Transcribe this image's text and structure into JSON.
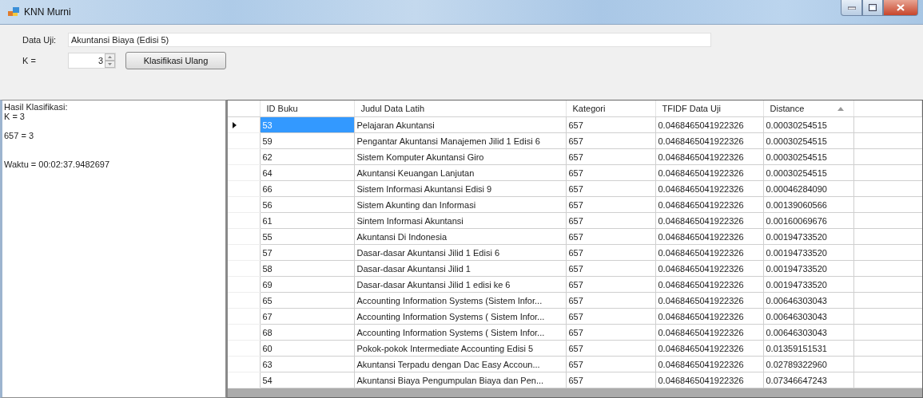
{
  "window": {
    "title": "KNN Murni"
  },
  "form": {
    "data_uji": {
      "label": "Data Uji:",
      "value": "Akuntansi Biaya (Edisi 5)"
    },
    "k": {
      "label": "K =",
      "value": "3"
    },
    "button": "Klasifikasi Ulang"
  },
  "result_text": "Hasil Klasifikasi:\nK = 3\n\n657 = 3\n\n\nWaktu = 00:02:37.9482697",
  "table": {
    "columns": [
      {
        "label": "ID Buku",
        "sorted": false
      },
      {
        "label": "Judul Data Latih",
        "sorted": false
      },
      {
        "label": "Kategori",
        "sorted": false
      },
      {
        "label": "TFIDF Data Uji",
        "sorted": false
      },
      {
        "label": "Distance",
        "sorted": true
      }
    ],
    "rows": [
      {
        "selected": true,
        "cells": [
          "53",
          "Pelajaran Akuntansi",
          "657",
          "0.0468465041922326",
          "0.00030254515"
        ]
      },
      {
        "selected": false,
        "cells": [
          "59",
          "Pengantar Akuntansi Manajemen Jilid 1 Edisi 6",
          "657",
          "0.0468465041922326",
          "0.00030254515"
        ]
      },
      {
        "selected": false,
        "cells": [
          "62",
          "Sistem Komputer Akuntansi Giro",
          "657",
          "0.0468465041922326",
          "0.00030254515"
        ]
      },
      {
        "selected": false,
        "cells": [
          "64",
          "Akuntansi Keuangan Lanjutan",
          "657",
          "0.0468465041922326",
          "0.00030254515"
        ]
      },
      {
        "selected": false,
        "cells": [
          "66",
          "Sistem Informasi Akuntansi Edisi 9",
          "657",
          "0.0468465041922326",
          "0.00046284090"
        ]
      },
      {
        "selected": false,
        "cells": [
          "56",
          "Sistem Akunting dan Informasi",
          "657",
          "0.0468465041922326",
          "0.00139060566"
        ]
      },
      {
        "selected": false,
        "cells": [
          "61",
          "Sintem Informasi Akuntansi",
          "657",
          "0.0468465041922326",
          "0.00160069676"
        ]
      },
      {
        "selected": false,
        "cells": [
          "55",
          "Akuntansi Di Indonesia",
          "657",
          "0.0468465041922326",
          "0.00194733520"
        ]
      },
      {
        "selected": false,
        "cells": [
          "57",
          "Dasar-dasar Akuntansi  Jilid 1 Edisi 6",
          "657",
          "0.0468465041922326",
          "0.00194733520"
        ]
      },
      {
        "selected": false,
        "cells": [
          "58",
          "Dasar-dasar Akuntansi Jilid 1",
          "657",
          "0.0468465041922326",
          "0.00194733520"
        ]
      },
      {
        "selected": false,
        "cells": [
          "69",
          "Dasar-dasar Akuntansi Jilid 1 edisi ke 6",
          "657",
          "0.0468465041922326",
          "0.00194733520"
        ]
      },
      {
        "selected": false,
        "cells": [
          "65",
          "Accounting Information Systems (Sistem Infor...",
          "657",
          "0.0468465041922326",
          "0.00646303043"
        ]
      },
      {
        "selected": false,
        "cells": [
          "67",
          "Accounting Information Systems ( Sistem Infor...",
          "657",
          "0.0468465041922326",
          "0.00646303043"
        ]
      },
      {
        "selected": false,
        "cells": [
          "68",
          "Accounting Information Systems ( Sistem Infor...",
          "657",
          "0.0468465041922326",
          "0.00646303043"
        ]
      },
      {
        "selected": false,
        "cells": [
          "60",
          "Pokok-pokok Intermediate Accounting Edisi 5",
          "657",
          "0.0468465041922326",
          "0.01359151531"
        ]
      },
      {
        "selected": false,
        "cells": [
          "63",
          "Akuntansi Terpadu dengan Dac Easy Accoun...",
          "657",
          "0.0468465041922326",
          "0.02789322960"
        ]
      },
      {
        "selected": false,
        "cells": [
          "54",
          "Akuntansi Biaya Pengumpulan Biaya dan Pen...",
          "657",
          "0.0468465041922326",
          "0.07346647243"
        ]
      }
    ]
  }
}
